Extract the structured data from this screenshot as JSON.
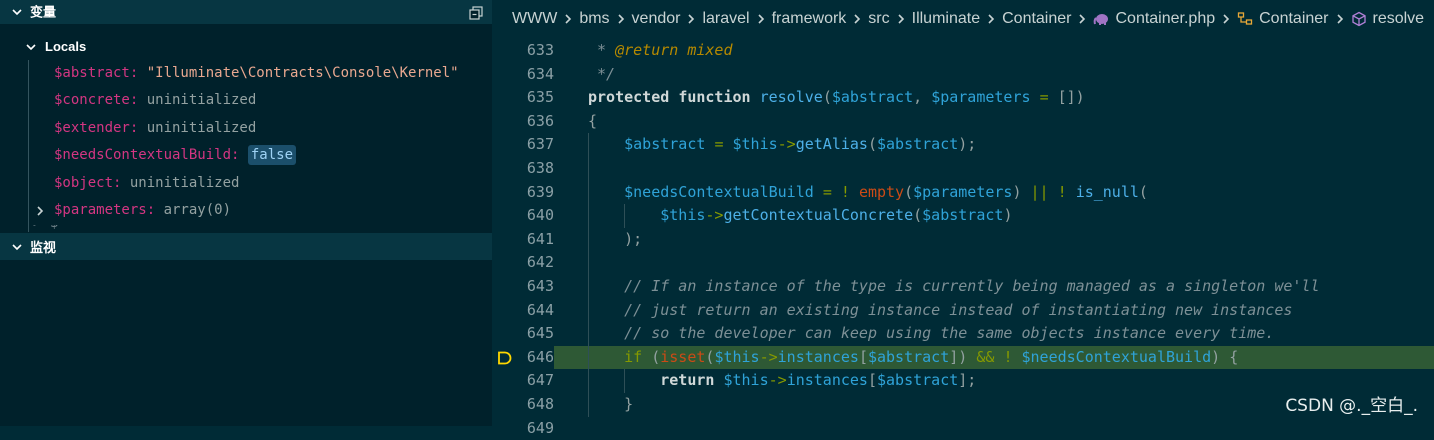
{
  "sidebar": {
    "variables_title": "变量",
    "locals_label": "Locals",
    "watch_title": "监视",
    "variables": [
      {
        "name": "$abstract",
        "value": "\"Illuminate\\Contracts\\Console\\Kernel\"",
        "kind": "string",
        "expandable": false
      },
      {
        "name": "$concrete",
        "value": "uninitialized",
        "kind": "plain",
        "expandable": false
      },
      {
        "name": "$extender",
        "value": "uninitialized",
        "kind": "plain",
        "expandable": false
      },
      {
        "name": "$needsContextualBuild",
        "value": "false",
        "kind": "bool",
        "expandable": false
      },
      {
        "name": "$object",
        "value": "uninitialized",
        "kind": "plain",
        "expandable": false
      },
      {
        "name": "$parameters",
        "value": "array(0)",
        "kind": "plain",
        "expandable": true
      }
    ]
  },
  "breadcrumb": {
    "items": [
      "WWW",
      "bms",
      "vendor",
      "laravel",
      "framework",
      "src",
      "Illuminate",
      "Container"
    ],
    "file": "Container.php",
    "class_name": "Container",
    "method_name": "resolve"
  },
  "editor": {
    "current_line": 646,
    "lines": [
      {
        "n": "633",
        "indent": 0,
        "tokens": [
          [
            " * ",
            "cmt"
          ],
          [
            "@return",
            "tag"
          ],
          [
            " mixed",
            "tag"
          ]
        ]
      },
      {
        "n": "634",
        "indent": 0,
        "tokens": [
          [
            " */",
            "cmt"
          ]
        ]
      },
      {
        "n": "635",
        "indent": 0,
        "tokens": [
          [
            "protected",
            "kw"
          ],
          [
            " ",
            "plain"
          ],
          [
            "function",
            "kw"
          ],
          [
            " ",
            "plain"
          ],
          [
            "resolve",
            "fn"
          ],
          [
            "(",
            "punc"
          ],
          [
            "$abstract",
            "var"
          ],
          [
            ", ",
            "punc"
          ],
          [
            "$parameters",
            "var"
          ],
          [
            " ",
            "plain"
          ],
          [
            "=",
            "op"
          ],
          [
            " [])",
            "punc"
          ]
        ]
      },
      {
        "n": "636",
        "indent": 0,
        "tokens": [
          [
            "{",
            "punc"
          ]
        ]
      },
      {
        "n": "637",
        "indent": 1,
        "tokens": [
          [
            "$abstract",
            "var"
          ],
          [
            " ",
            "plain"
          ],
          [
            "=",
            "op"
          ],
          [
            " ",
            "plain"
          ],
          [
            "$this",
            "this"
          ],
          [
            "->",
            "op"
          ],
          [
            "getAlias",
            "fn"
          ],
          [
            "(",
            "punc"
          ],
          [
            "$abstract",
            "var"
          ],
          [
            ");",
            "punc"
          ]
        ]
      },
      {
        "n": "638",
        "indent": 1,
        "tokens": []
      },
      {
        "n": "639",
        "indent": 1,
        "tokens": [
          [
            "$needsContextualBuild",
            "var"
          ],
          [
            " ",
            "plain"
          ],
          [
            "=",
            "op"
          ],
          [
            " ",
            "plain"
          ],
          [
            "!",
            "op"
          ],
          [
            " ",
            "plain"
          ],
          [
            "empty",
            "builtin"
          ],
          [
            "(",
            "punc"
          ],
          [
            "$parameters",
            "var"
          ],
          [
            ") ",
            "punc"
          ],
          [
            "||",
            "op"
          ],
          [
            " ",
            "plain"
          ],
          [
            "!",
            "op"
          ],
          [
            " ",
            "plain"
          ],
          [
            "is_null",
            "fn"
          ],
          [
            "(",
            "punc"
          ]
        ]
      },
      {
        "n": "640",
        "indent": 2,
        "tokens": [
          [
            "$this",
            "this"
          ],
          [
            "->",
            "op"
          ],
          [
            "getContextualConcrete",
            "fn"
          ],
          [
            "(",
            "punc"
          ],
          [
            "$abstract",
            "var"
          ],
          [
            ")",
            "punc"
          ]
        ]
      },
      {
        "n": "641",
        "indent": 1,
        "tokens": [
          [
            ");",
            "punc"
          ]
        ]
      },
      {
        "n": "642",
        "indent": 1,
        "tokens": []
      },
      {
        "n": "643",
        "indent": 1,
        "tokens": [
          [
            "// If an instance of the type is currently being managed as a singleton we'll",
            "cmt"
          ]
        ]
      },
      {
        "n": "644",
        "indent": 1,
        "tokens": [
          [
            "// just return an existing instance instead of instantiating new instances",
            "cmt"
          ]
        ]
      },
      {
        "n": "645",
        "indent": 1,
        "tokens": [
          [
            "// so the developer can keep using the same objects instance every time.",
            "cmt"
          ]
        ]
      },
      {
        "n": "646",
        "indent": 1,
        "tokens": [
          [
            "if",
            "ctrl"
          ],
          [
            " (",
            "punc"
          ],
          [
            "isset",
            "builtin"
          ],
          [
            "(",
            "punc"
          ],
          [
            "$this",
            "this"
          ],
          [
            "->",
            "op"
          ],
          [
            "instances",
            "var"
          ],
          [
            "[",
            "punc"
          ],
          [
            "$abstract",
            "var"
          ],
          [
            "]) ",
            "punc"
          ],
          [
            "&&",
            "op"
          ],
          [
            " ",
            "plain"
          ],
          [
            "!",
            "op"
          ],
          [
            " ",
            "plain"
          ],
          [
            "$needsContextualBuild",
            "var"
          ],
          [
            ") {",
            "punc"
          ]
        ]
      },
      {
        "n": "647",
        "indent": 2,
        "tokens": [
          [
            "return",
            "kw"
          ],
          [
            " ",
            "plain"
          ],
          [
            "$this",
            "this"
          ],
          [
            "->",
            "op"
          ],
          [
            "instances",
            "var"
          ],
          [
            "[",
            "punc"
          ],
          [
            "$abstract",
            "var"
          ],
          [
            "];",
            "punc"
          ]
        ]
      },
      {
        "n": "648",
        "indent": 1,
        "tokens": [
          [
            "}",
            "punc"
          ]
        ]
      },
      {
        "n": "649",
        "indent": 1,
        "tokens": []
      }
    ]
  },
  "watermark": "CSDN @._空白_."
}
